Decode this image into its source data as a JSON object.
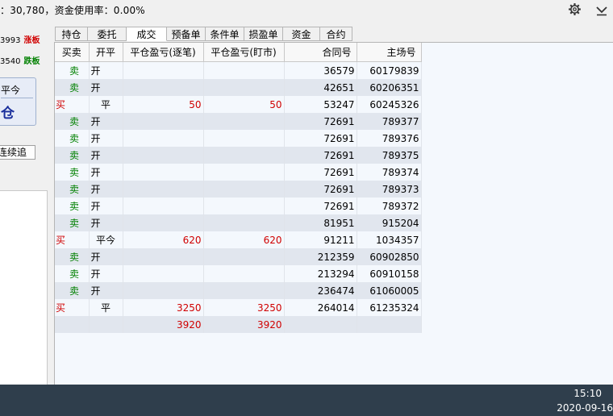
{
  "status_bar": {
    "text": "：30,780，资金使用率：0.00%"
  },
  "icons": {
    "settings": "gear-icon",
    "collapse": "chevron-down-icon"
  },
  "left_panel": {
    "row1": {
      "code": "3993",
      "label": "涨板"
    },
    "row2": {
      "code": "3540",
      "label": "跌板"
    },
    "order_box": {
      "line1": "平今",
      "line2": "仓"
    },
    "chase_button": "连续追"
  },
  "tabs": [
    {
      "label": "持仓",
      "active": false
    },
    {
      "label": "委托",
      "active": false
    },
    {
      "label": "成交",
      "active": true
    },
    {
      "label": "预备单",
      "active": false
    },
    {
      "label": "条件单",
      "active": false
    },
    {
      "label": "损盈单",
      "active": false
    },
    {
      "label": "资金",
      "active": false
    },
    {
      "label": "合约",
      "active": false
    }
  ],
  "table": {
    "columns": [
      "买卖",
      "开平",
      "平仓盈亏(逐笔)",
      "平仓盈亏(盯市)",
      "合同号",
      "主场号"
    ],
    "rows": [
      {
        "bs": "卖",
        "oc": "开",
        "pnl_trade": "",
        "pnl_mtm": "",
        "contract": "36579",
        "main": "60179839"
      },
      {
        "bs": "卖",
        "oc": "开",
        "pnl_trade": "",
        "pnl_mtm": "",
        "contract": "42651",
        "main": "60206351"
      },
      {
        "bs": "买",
        "oc": "平",
        "pnl_trade": "50",
        "pnl_mtm": "50",
        "contract": "53247",
        "main": "60245326"
      },
      {
        "bs": "卖",
        "oc": "开",
        "pnl_trade": "",
        "pnl_mtm": "",
        "contract": "72691",
        "main": "789377"
      },
      {
        "bs": "卖",
        "oc": "开",
        "pnl_trade": "",
        "pnl_mtm": "",
        "contract": "72691",
        "main": "789376"
      },
      {
        "bs": "卖",
        "oc": "开",
        "pnl_trade": "",
        "pnl_mtm": "",
        "contract": "72691",
        "main": "789375"
      },
      {
        "bs": "卖",
        "oc": "开",
        "pnl_trade": "",
        "pnl_mtm": "",
        "contract": "72691",
        "main": "789374"
      },
      {
        "bs": "卖",
        "oc": "开",
        "pnl_trade": "",
        "pnl_mtm": "",
        "contract": "72691",
        "main": "789373"
      },
      {
        "bs": "卖",
        "oc": "开",
        "pnl_trade": "",
        "pnl_mtm": "",
        "contract": "72691",
        "main": "789372"
      },
      {
        "bs": "卖",
        "oc": "开",
        "pnl_trade": "",
        "pnl_mtm": "",
        "contract": "81951",
        "main": "915204"
      },
      {
        "bs": "买",
        "oc": "平今",
        "pnl_trade": "620",
        "pnl_mtm": "620",
        "contract": "91211",
        "main": "1034357"
      },
      {
        "bs": "卖",
        "oc": "开",
        "pnl_trade": "",
        "pnl_mtm": "",
        "contract": "212359",
        "main": "60902850"
      },
      {
        "bs": "卖",
        "oc": "开",
        "pnl_trade": "",
        "pnl_mtm": "",
        "contract": "213294",
        "main": "60910158"
      },
      {
        "bs": "卖",
        "oc": "开",
        "pnl_trade": "",
        "pnl_mtm": "",
        "contract": "236474",
        "main": "61060005"
      },
      {
        "bs": "买",
        "oc": "平",
        "pnl_trade": "3250",
        "pnl_mtm": "3250",
        "contract": "264014",
        "main": "61235324"
      },
      {
        "bs": "",
        "oc": "",
        "pnl_trade": "3920",
        "pnl_mtm": "3920",
        "contract": "",
        "main": ""
      }
    ]
  },
  "clock": {
    "time": "15:10",
    "date": "2020-09-16"
  },
  "colors": {
    "buy": "#d00000",
    "sell": "#008000",
    "taskbar": "#2f3e4c",
    "row_alt": "#e1e6ee"
  }
}
